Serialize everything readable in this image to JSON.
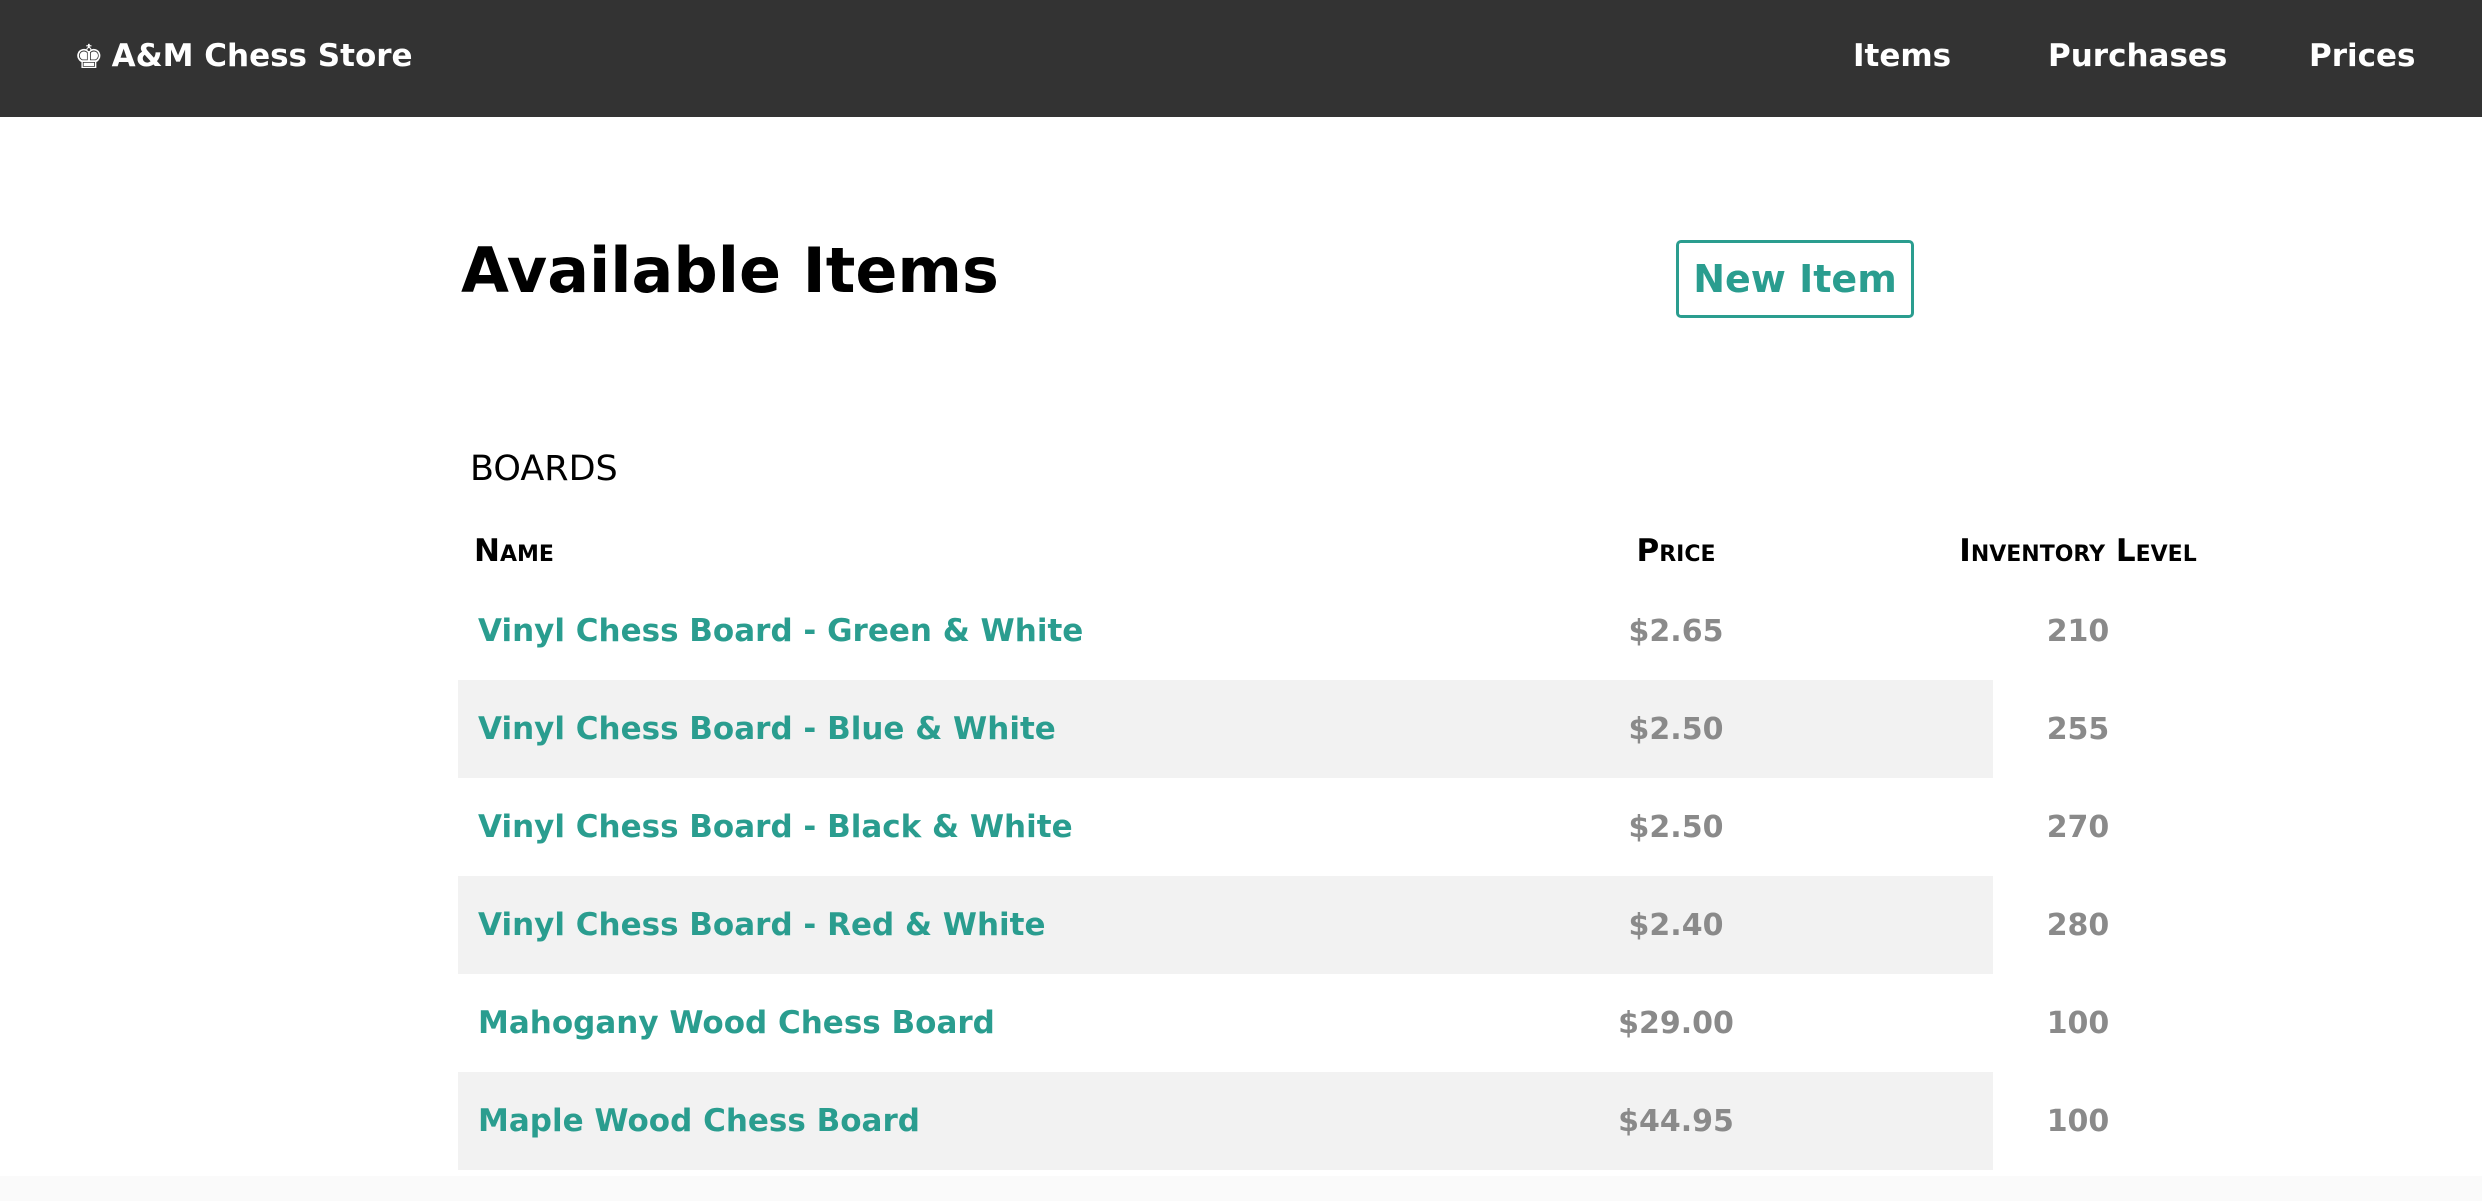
{
  "navbar": {
    "brand_icon": "♚",
    "brand_title": "A&M Chess Store",
    "links": [
      {
        "label": "Items"
      },
      {
        "label": "Purchases"
      },
      {
        "label": "Prices"
      }
    ]
  },
  "main": {
    "title": "Available Items",
    "new_item_label": "New Item",
    "section": {
      "title": "BOARDS",
      "columns": [
        "Name",
        "Price",
        "Inventory Level"
      ],
      "rows": [
        {
          "name": "Vinyl Chess Board - Green & White",
          "price": "$2.65",
          "inventory": "210"
        },
        {
          "name": "Vinyl Chess Board - Blue & White",
          "price": "$2.50",
          "inventory": "255"
        },
        {
          "name": "Vinyl Chess Board - Black & White",
          "price": "$2.50",
          "inventory": "270"
        },
        {
          "name": "Vinyl Chess Board - Red & White",
          "price": "$2.40",
          "inventory": "280"
        },
        {
          "name": "Mahogany Wood Chess Board",
          "price": "$29.00",
          "inventory": "100"
        },
        {
          "name": "Maple Wood Chess Board",
          "price": "$44.95",
          "inventory": "100"
        }
      ]
    }
  },
  "colors": {
    "navbar_bg": "#333333",
    "accent": "#2a9d8f",
    "row_shade": "#f2f2f2",
    "number_text": "#8a8a8a"
  },
  "icons": {
    "brand": "chess-king-icon"
  }
}
